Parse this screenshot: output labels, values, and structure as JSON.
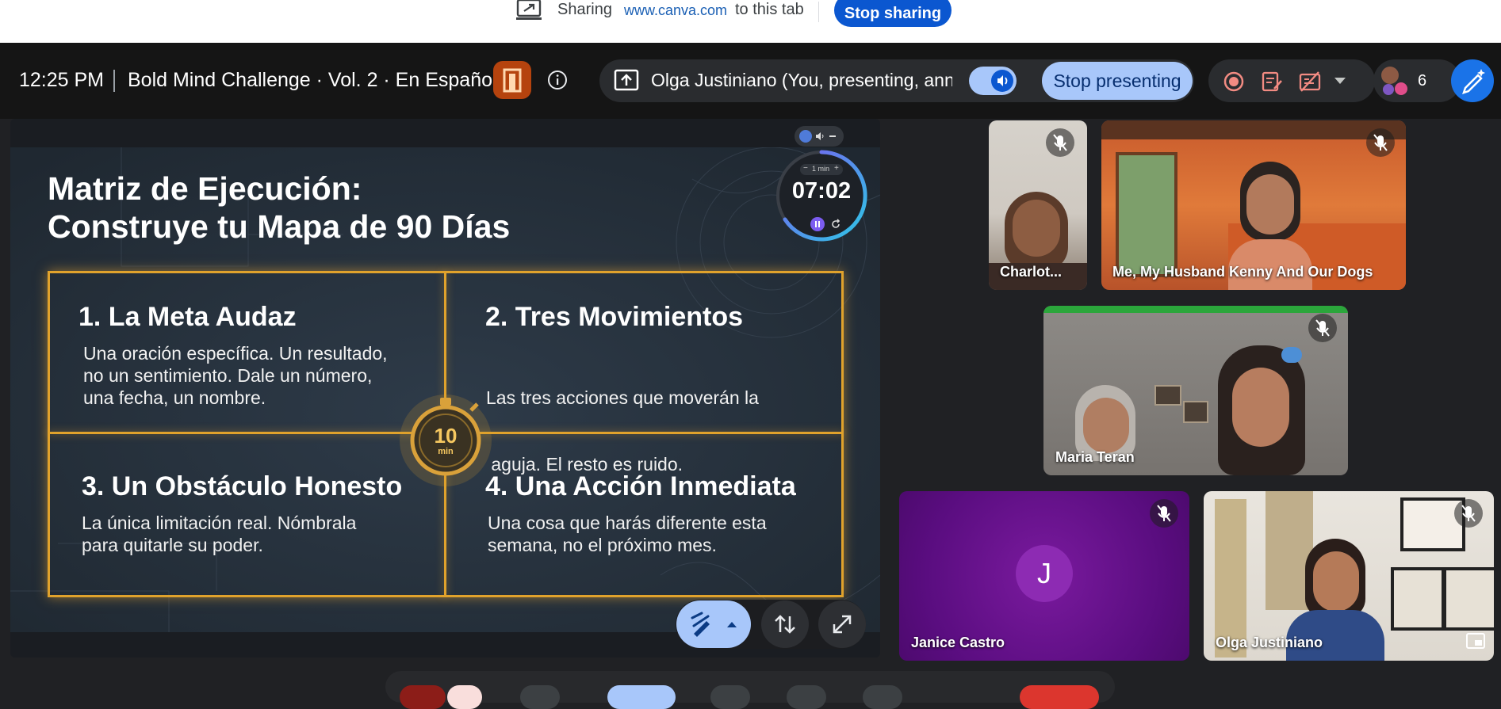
{
  "share_banner": {
    "sharing_label": "Sharing",
    "url": "www.canva.com",
    "suffix": "to this tab",
    "stop_label": "Stop sharing"
  },
  "meet_bar": {
    "time": "12:25 PM",
    "meeting_title": "Bold Mind Challenge · Vol. 2 · En Español",
    "presenter_label": "Olga Justiniano (You, presenting, ann...",
    "stop_presenting_label": "Stop presenting",
    "participant_count": "6",
    "accent": "#a8c7fa"
  },
  "slide": {
    "title_line1": "Matriz de Ejecución:",
    "title_line2": "Construye tu Mapa de 90 Días",
    "quadrants": [
      {
        "title": "1. La Meta Audaz",
        "body": [
          "Una oración específica. Un resultado,",
          "no un sentimiento. Dale un número,",
          "una fecha, un nombre."
        ]
      },
      {
        "title": "2. Tres Movimientos",
        "body": [
          "Las tres acciones que moverán la",
          " aguja. El resto es ruido."
        ]
      },
      {
        "title": "3. Un Obstáculo Honesto",
        "body": [
          "La única limitación real. Nómbrala",
          "para quitarle su poder."
        ]
      },
      {
        "title": "4. Una Acción Inmediata",
        "body": [
          "Una cosa que harás diferente esta",
          "semana, no el próximo mes."
        ]
      }
    ],
    "stopwatch_number": "10",
    "stopwatch_unit": "min",
    "accent": "#e0a22c"
  },
  "timer_widget": {
    "step_label": "1 min",
    "minus": "−",
    "plus": "+",
    "time": "07:02"
  },
  "participants": [
    {
      "name": "Charlot...",
      "muted": true
    },
    {
      "name": "Me, My Husband Kenny And Our Dogs",
      "muted": true
    },
    {
      "name": "Maria Teran",
      "muted": true
    },
    {
      "name": "Janice Castro",
      "initial": "J",
      "muted": true
    },
    {
      "name": "Olga Justiniano",
      "muted": true
    }
  ]
}
